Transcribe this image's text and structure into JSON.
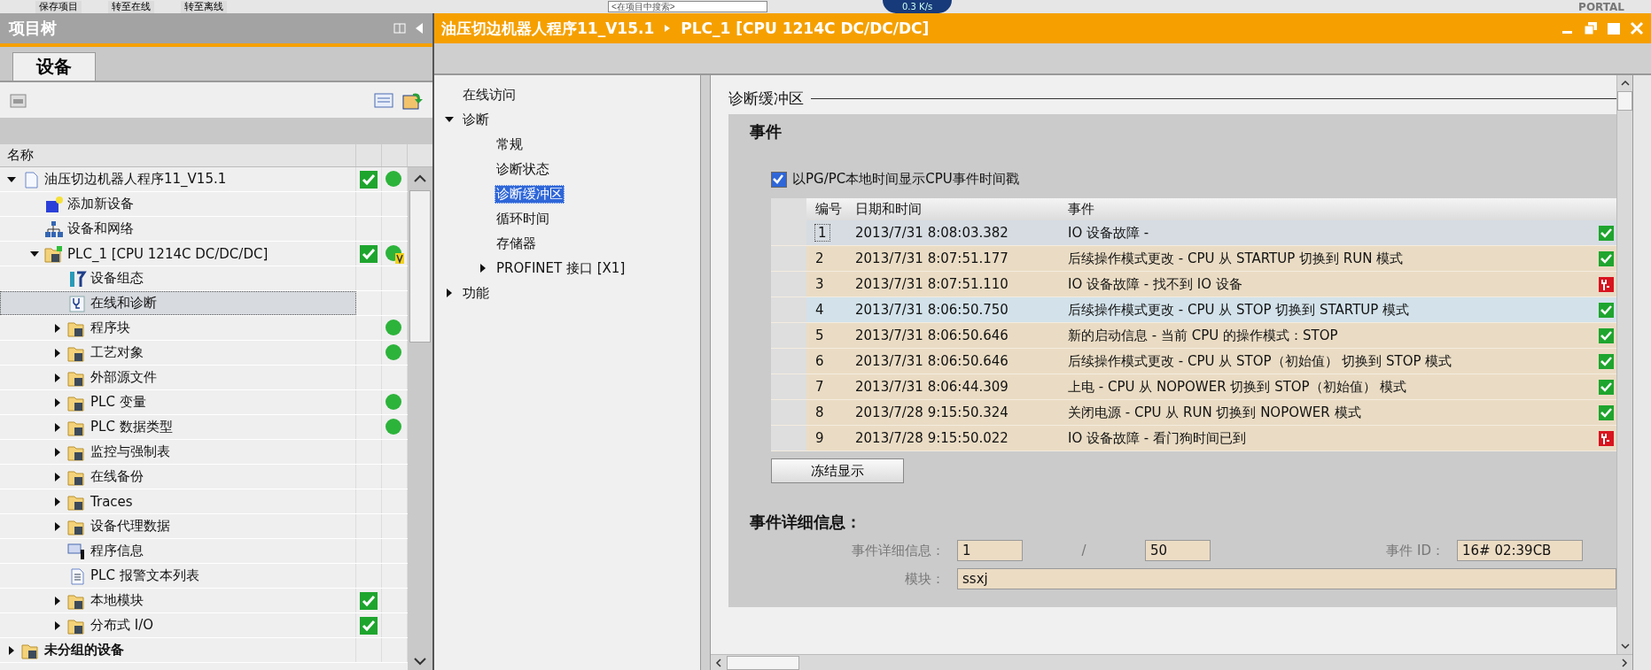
{
  "toolbar": {
    "items": [
      {
        "kind": "button",
        "label": "保存项目"
      },
      {
        "kind": "button",
        "label": "转至在线"
      },
      {
        "kind": "button",
        "label": "转至离线"
      }
    ],
    "search": {
      "placeholder": "<在项目中搜索>"
    },
    "speed": "0.3 K/s",
    "brand": "PORTAL"
  },
  "project_tree": {
    "title": "项目树",
    "tab": "设备",
    "column": "名称",
    "items": [
      {
        "label": "油压切边机器人程序11_V15.1",
        "kind": "project",
        "expanded": true,
        "selected": false,
        "consistent": true,
        "online": true,
        "children": [
          {
            "label": "添加新设备",
            "kind": "add",
            "selected": false
          },
          {
            "label": "设备和网络",
            "kind": "network",
            "selected": false
          },
          {
            "label": "PLC_1 [CPU 1214C DC/DC/DC]",
            "kind": "plc",
            "expanded": true,
            "selected": false,
            "consistent": true,
            "online": true,
            "version": true,
            "children": [
              {
                "label": "设备组态",
                "kind": "config",
                "selected": false
              },
              {
                "label": "在线和诊断",
                "kind": "diagnostics",
                "selected": true
              },
              {
                "label": "程序块",
                "kind": "folder",
                "expanded": false,
                "selected": false,
                "online": true
              },
              {
                "label": "工艺对象",
                "kind": "folder",
                "expanded": false,
                "selected": false,
                "online": true
              },
              {
                "label": "外部源文件",
                "kind": "folder",
                "expanded": false,
                "selected": false
              },
              {
                "label": "PLC 变量",
                "kind": "folder",
                "expanded": false,
                "selected": false,
                "online": true
              },
              {
                "label": "PLC 数据类型",
                "kind": "folder",
                "expanded": false,
                "selected": false,
                "online": true
              },
              {
                "label": "监控与强制表",
                "kind": "folder",
                "expanded": false,
                "selected": false
              },
              {
                "label": "在线备份",
                "kind": "folder",
                "expanded": false,
                "selected": false
              },
              {
                "label": "Traces",
                "kind": "folder",
                "expanded": false,
                "selected": false
              },
              {
                "label": "设备代理数据",
                "kind": "folder",
                "expanded": false,
                "selected": false
              },
              {
                "label": "程序信息",
                "kind": "info",
                "selected": false
              },
              {
                "label": "PLC 报警文本列表",
                "kind": "textlist",
                "selected": false
              },
              {
                "label": "本地模块",
                "kind": "folder",
                "expanded": false,
                "selected": false,
                "consistent": true
              },
              {
                "label": "分布式 I/O",
                "kind": "folder",
                "expanded": false,
                "selected": false,
                "consistent": true
              }
            ]
          }
        ]
      },
      {
        "label": "未分组的设备",
        "kind": "folder",
        "expanded": false,
        "selected": false
      }
    ]
  },
  "editor": {
    "title": "油压切边机器人程序11_V15.1",
    "breadcrumb": "PLC_1 [CPU 1214C DC/DC/DC]",
    "nav": [
      {
        "label": "在线访问",
        "selected": false
      },
      {
        "label": "诊断",
        "expanded": true,
        "selected": false,
        "children": [
          {
            "label": "常规",
            "selected": false
          },
          {
            "label": "诊断状态",
            "selected": false
          },
          {
            "label": "诊断缓冲区",
            "selected": true
          },
          {
            "label": "循环时间",
            "selected": false
          },
          {
            "label": "存储器",
            "selected": false
          },
          {
            "label": "PROFINET 接口 [X1]",
            "expanded": false,
            "selected": false
          }
        ]
      },
      {
        "label": "功能",
        "expanded": false,
        "selected": false
      }
    ],
    "section_title": "诊断缓冲区",
    "events_title": "事件",
    "local_time": {
      "label": "以PG/PC本地时间显示CPU事件时间戳",
      "checked": true
    },
    "table": {
      "columns": [
        "编号",
        "日期和时间",
        "事件"
      ],
      "rows": [
        {
          "no": "1",
          "time": "2013/7/31 8:08:03.382",
          "event": "IO 设备故障 -",
          "kind": "ok",
          "selected": true,
          "highlighted": false
        },
        {
          "no": "2",
          "time": "2013/7/31 8:07:51.177",
          "event": "后续操作模式更改  - CPU 从 STARTUP 切换到 RUN 模式",
          "kind": "ok",
          "selected": false,
          "highlighted": false
        },
        {
          "no": "3",
          "time": "2013/7/31 8:07:51.110",
          "event": "IO 设备故障 - 找不到 IO 设备",
          "kind": "fault",
          "selected": false,
          "highlighted": false
        },
        {
          "no": "4",
          "time": "2013/7/31 8:06:50.750",
          "event": "后续操作模式更改  - CPU 从 STOP 切换到 STARTUP 模式",
          "kind": "ok",
          "selected": false,
          "highlighted": true
        },
        {
          "no": "5",
          "time": "2013/7/31 8:06:50.646",
          "event": "新的启动信息 - 当前 CPU 的操作模式：STOP",
          "kind": "ok",
          "selected": false,
          "highlighted": false
        },
        {
          "no": "6",
          "time": "2013/7/31 8:06:50.646",
          "event": "后续操作模式更改  - CPU 从 STOP（初始值） 切换到 STOP 模式",
          "kind": "ok",
          "selected": false,
          "highlighted": false
        },
        {
          "no": "7",
          "time": "2013/7/31 8:06:44.309",
          "event": "上电 - CPU 从 NOPOWER 切换到 STOP（初始值） 模式",
          "kind": "ok",
          "selected": false,
          "highlighted": false
        },
        {
          "no": "8",
          "time": "2013/7/28 9:15:50.324",
          "event": "关闭电源 - CPU 从 RUN 切换到 NOPOWER 模式",
          "kind": "ok",
          "selected": false,
          "highlighted": false
        },
        {
          "no": "9",
          "time": "2013/7/28 9:15:50.022",
          "event": "IO 设备故障 - 看门狗时间已到",
          "kind": "fault",
          "selected": false,
          "highlighted": false
        }
      ]
    },
    "freeze_button": "冻结显示",
    "details": {
      "title": "事件详细信息：",
      "label": "事件详细信息：",
      "index": "1",
      "separator": "/",
      "total": "50",
      "id_label": "事件 ID：",
      "id": "16# 02:39CB",
      "module_label": "模块：",
      "module": "ssxj"
    }
  }
}
